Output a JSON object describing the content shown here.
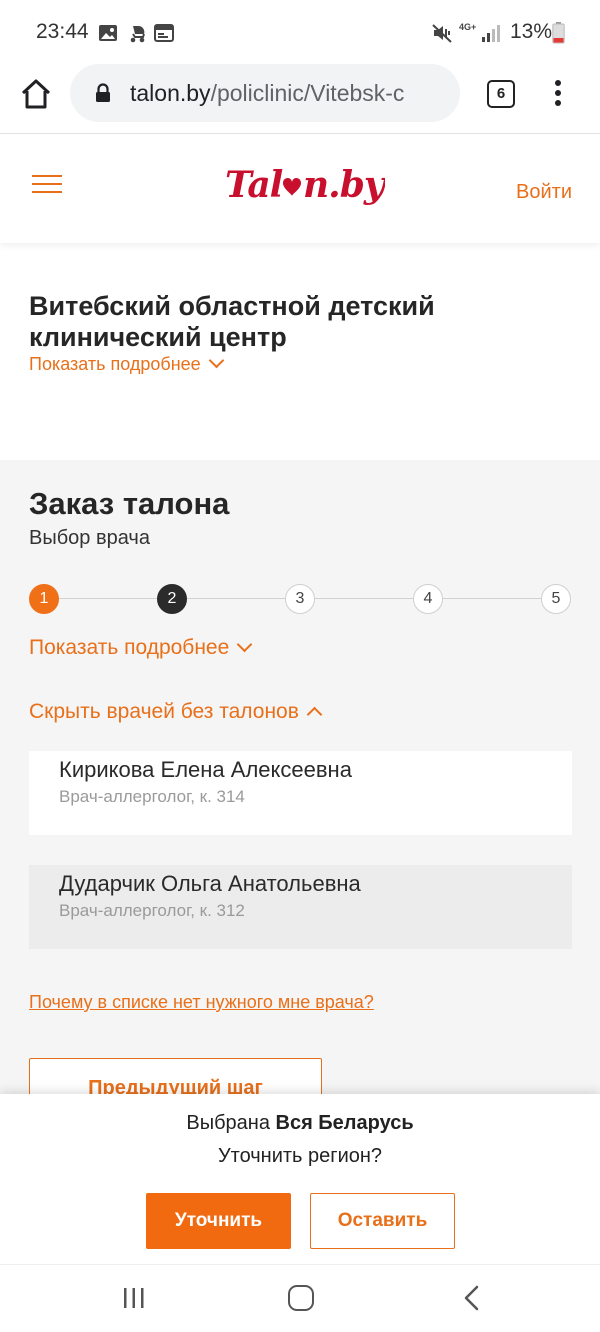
{
  "status_bar": {
    "time": "23:44",
    "battery": "13%",
    "network": "4G+",
    "icons_left": [
      "image-icon",
      "stroller-icon",
      "calendar-icon"
    ],
    "icons_right": [
      "mute-vibrate-icon",
      "network-icon",
      "signal-icon",
      "battery-icon"
    ]
  },
  "browser": {
    "url_host": "talon.by",
    "url_path": "/policlinic/Vitebsk-c",
    "tab_count": "6"
  },
  "header": {
    "logo_text": "Talon.by",
    "login_label": "Войти",
    "accent_color": "#e8701a",
    "brand_color": "#c8102e"
  },
  "clinic": {
    "title": "Витебский областной детский клинический центр",
    "more_label": "Показать подробнее"
  },
  "order": {
    "title": "Заказ талона",
    "subtitle": "Выбор врача",
    "steps": [
      {
        "label": "1",
        "state": "done"
      },
      {
        "label": "2",
        "state": "current"
      },
      {
        "label": "3",
        "state": "todo"
      },
      {
        "label": "4",
        "state": "todo"
      },
      {
        "label": "5",
        "state": "todo"
      }
    ],
    "steps_more_label": "Показать подробнее",
    "hide_doctors_label": "Скрыть врачей без талонов",
    "doctors": [
      {
        "name": "Кирикова Елена Алексеевна",
        "spec": "Врач-аллерголог, к. 314"
      },
      {
        "name": "Дударчик Ольга Анатольевна",
        "spec": "Врач-аллерголог, к. 312"
      }
    ],
    "why_link": "Почему в списке нет нужного мне врача?",
    "prev_button": "Предыдущий шаг"
  },
  "region_popup": {
    "line1_prefix": "Выбрана",
    "line1_region": "Вся Беларусь",
    "line2": "Уточнить регион?",
    "refine_button": "Уточнить",
    "keep_button": "Оставить"
  }
}
